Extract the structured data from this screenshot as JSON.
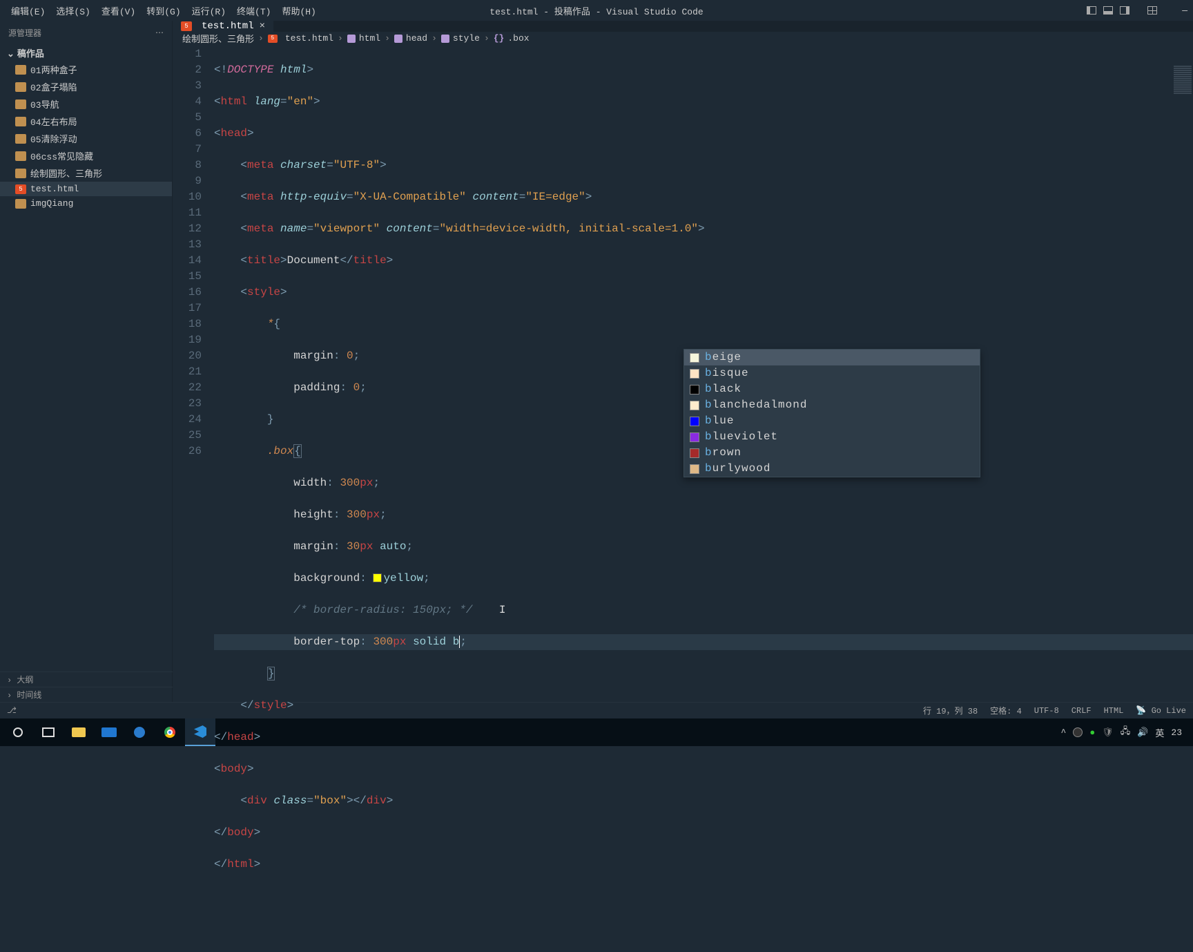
{
  "menubar": {
    "items": [
      "编辑(E)",
      "选择(S)",
      "查看(V)",
      "转到(G)",
      "运行(R)",
      "终端(T)",
      "帮助(H)"
    ],
    "title": "test.html - 投稿作品 - Visual Studio Code"
  },
  "sidebar": {
    "header": "源管理器",
    "root": "稿作品",
    "items": [
      {
        "icon": "folder",
        "label": "01两种盒子"
      },
      {
        "icon": "folder",
        "label": "02盒子塌陷"
      },
      {
        "icon": "folder",
        "label": "03导航"
      },
      {
        "icon": "folder",
        "label": "04左右布局"
      },
      {
        "icon": "folder",
        "label": "05清除浮动"
      },
      {
        "icon": "folder",
        "label": "06css常见隐藏"
      },
      {
        "icon": "folder",
        "label": "绘制圆形、三角形"
      },
      {
        "icon": "html",
        "label": "test.html",
        "active": true
      },
      {
        "icon": "folder",
        "label": "imgQiang"
      }
    ],
    "outline_rows": [
      "大纲",
      "时间线"
    ]
  },
  "tabs": [
    {
      "icon": "html",
      "label": "test.html"
    }
  ],
  "breadcrumb": [
    "绘制圆形、三角形",
    "test.html",
    "html",
    "head",
    "style",
    ".box"
  ],
  "editor": {
    "line_count": 26,
    "current_line": 19,
    "suggest": [
      {
        "color": "#f5f5dc",
        "label": "beige",
        "selected": true
      },
      {
        "color": "#ffe4c4",
        "label": "bisque"
      },
      {
        "color": "#000000",
        "label": "black"
      },
      {
        "color": "#ffebcd",
        "label": "blanchedalmond"
      },
      {
        "color": "#0000ff",
        "label": "blue"
      },
      {
        "color": "#8a2be2",
        "label": "blueviolet"
      },
      {
        "color": "#a52a2a",
        "label": "brown"
      },
      {
        "color": "#deb887",
        "label": "burlywood"
      }
    ]
  },
  "statusbar": {
    "cursor": "行 19，列 38",
    "spaces": "空格: 4",
    "encoding": "UTF-8",
    "eol": "CRLF",
    "lang": "HTML",
    "golive": "Go Live"
  },
  "taskbar": {
    "ime": "英",
    "time": "23"
  }
}
